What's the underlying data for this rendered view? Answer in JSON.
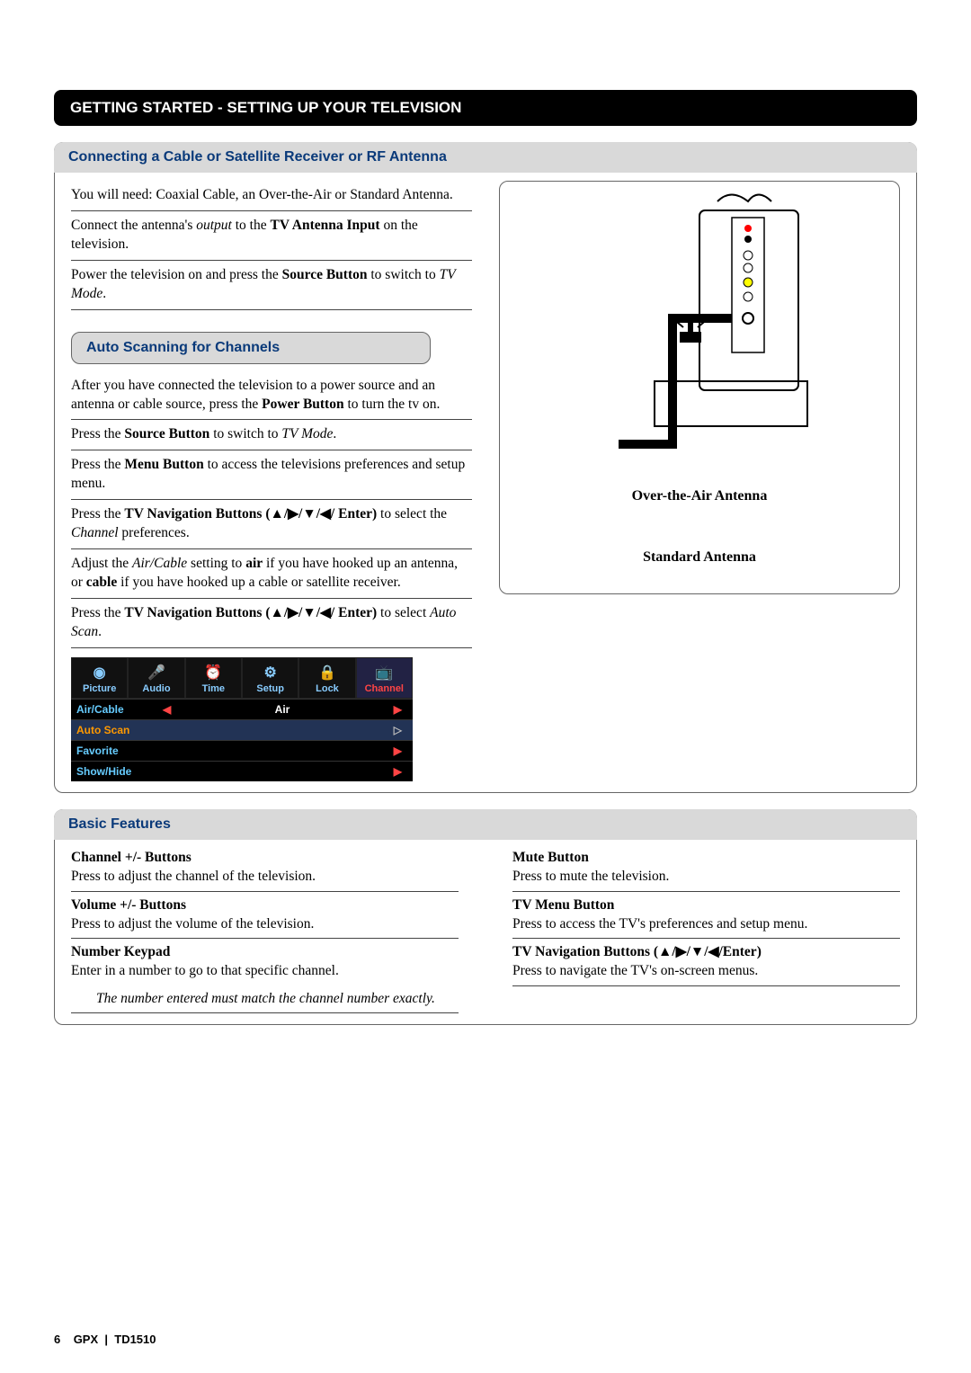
{
  "banner": "GETTING STARTED - SETTING UP YOUR TELEVISION",
  "section1": {
    "heading": "Connecting a Cable or Satellite Receiver or RF Antenna",
    "p1_a": "You will need: Coaxial Cable, an Over-the-Air or Standard Antenna.",
    "p2_a": "Connect the antenna's ",
    "p2_b": "output",
    "p2_c": " to the ",
    "p2_d": "TV Antenna Input",
    "p2_e": " on the television.",
    "p3_a": "Power the television on and press the ",
    "p3_b": "Source Button",
    "p3_c": " to switch to ",
    "p3_d": "TV Mode",
    "p3_e": "."
  },
  "section2": {
    "heading": "Auto Scanning for Channels",
    "p1_a": "After you have connected the television to a power source and an antenna or cable source, press the ",
    "p1_b": "Power Button",
    "p1_c": " to turn the tv on.",
    "p2_a": "Press the ",
    "p2_b": "Source Button",
    "p2_c": " to switch to ",
    "p2_d": "TV Mode",
    "p2_e": ".",
    "p3_a": "Press the ",
    "p3_b": "Menu Button",
    "p3_c": " to access the televisions preferences and setup menu.",
    "p4_a": "Press the ",
    "p4_b": "TV Navigation Buttons (▲/▶/▼/◀/ Enter)",
    "p4_c": " to select the ",
    "p4_d": "Channel",
    "p4_e": " preferences.",
    "p5_a": "Adjust the ",
    "p5_b": "Air/Cable",
    "p5_c": " setting to ",
    "p5_d": "air",
    "p5_e": " if you have hooked up an antenna, or ",
    "p5_f": "cable",
    "p5_g": " if you have hooked up a cable or satellite receiver.",
    "p6_a": "Press the ",
    "p6_b": "TV Navigation Buttons (▲/▶/▼/◀/ Enter)",
    "p6_c": " to select ",
    "p6_d": "Auto Scan",
    "p6_e": "."
  },
  "diagram": {
    "label1": "Over-the-Air Antenna",
    "label2": "Standard Antenna"
  },
  "menu": {
    "tabs": [
      "Picture",
      "Audio",
      "Time",
      "Setup",
      "Lock",
      "Channel"
    ],
    "rows": [
      {
        "label": "Air/Cable",
        "value": "Air",
        "arrows": true
      },
      {
        "label": "Auto Scan",
        "value": "",
        "arrows": "right"
      },
      {
        "label": "Favorite",
        "value": "",
        "arrows": "right"
      },
      {
        "label": "Show/Hide",
        "value": "",
        "arrows": "right"
      }
    ]
  },
  "basic": {
    "heading": "Basic Features",
    "left": [
      {
        "head": "Channel +/- Buttons",
        "body": "Press to adjust the channel of the television."
      },
      {
        "head": "Volume +/- Buttons",
        "body": "Press to adjust the volume of the television."
      },
      {
        "head": "Number Keypad",
        "body": "Enter in a number to go to that specific channel."
      }
    ],
    "note": "The number entered must match the channel number exactly.",
    "right": [
      {
        "head": "Mute Button",
        "body": "Press to mute the television."
      },
      {
        "head": "TV Menu Button",
        "body": "Press to access the TV's preferences and setup menu."
      },
      {
        "head": "TV Navigation Buttons (▲/▶/▼/◀/Enter)",
        "body": "Press to navigate the TV's on-screen menus."
      }
    ]
  },
  "footer": {
    "page": "6",
    "brand": "GPX",
    "model": "TD1510"
  }
}
